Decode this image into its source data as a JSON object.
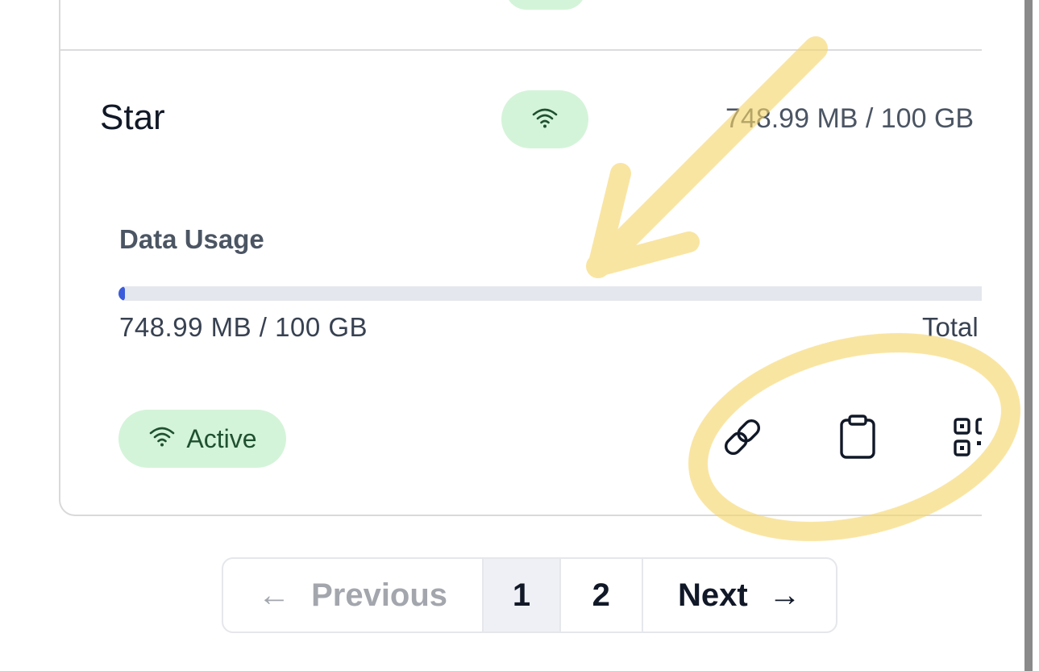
{
  "device": {
    "name": "Star",
    "usage_summary": "748.99 MB / 100 GB",
    "signal_icon": "wifi-icon"
  },
  "data_usage": {
    "title": "Data Usage",
    "used_label": "748.99 MB / 100 GB",
    "total_label": "Total",
    "percent": 0.75
  },
  "status": {
    "label": "Active",
    "icon": "wifi-icon"
  },
  "actions": [
    {
      "icon": "link-icon"
    },
    {
      "icon": "clipboard-icon"
    },
    {
      "icon": "qr-code-icon"
    }
  ],
  "pagination": {
    "previous_label": "Previous",
    "pages": [
      "1",
      "2"
    ],
    "current_page": "1",
    "next_label": "Next",
    "prev_arrow": "←",
    "next_arrow": "→"
  },
  "colors": {
    "accent": "#3b5bdb",
    "status_bg": "#d4f4d9",
    "status_text": "#1f5130",
    "annotation": "#f5d66a"
  }
}
